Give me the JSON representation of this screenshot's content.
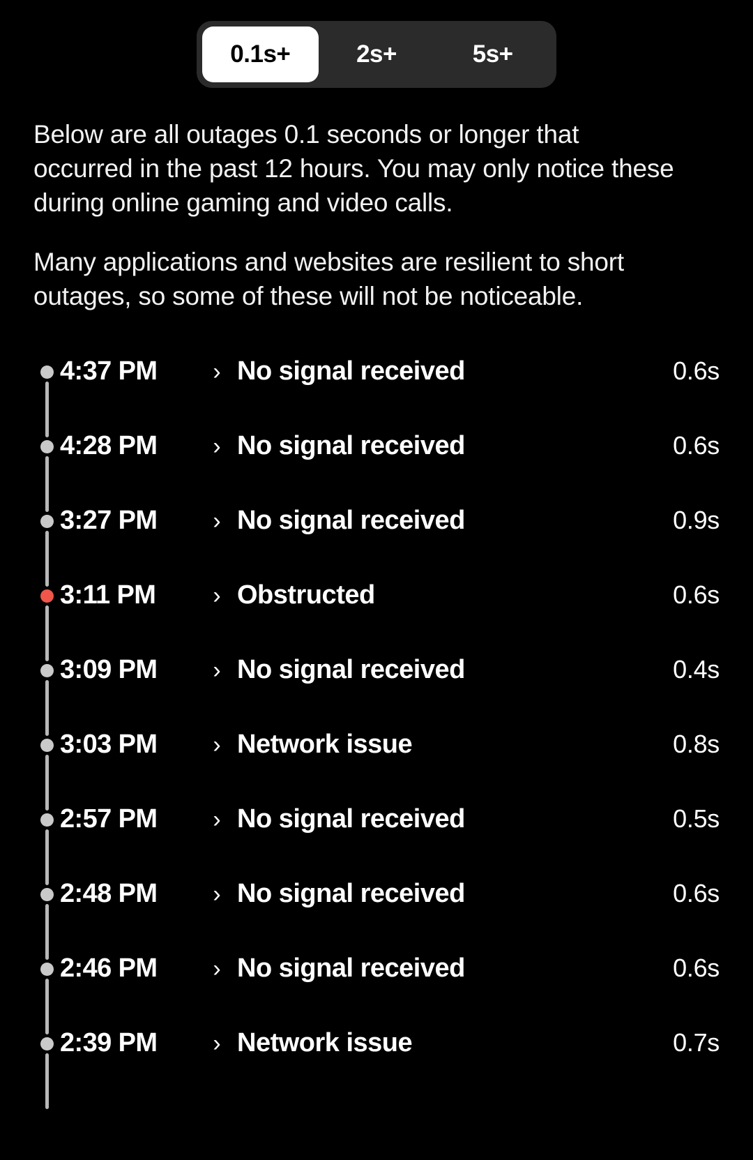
{
  "filter": {
    "options": [
      {
        "label": "0.1s+",
        "active": true
      },
      {
        "label": "2s+",
        "active": false
      },
      {
        "label": "5s+",
        "active": false
      }
    ]
  },
  "description": {
    "paragraph1": "Below are all outages 0.1 seconds or longer that occurred in the past 12 hours. You may only notice these during online gaming and video calls.",
    "paragraph2": "Many applications and websites are resilient to short outages, so some of these will not be noticeable."
  },
  "colors": {
    "background": "#000000",
    "dot_normal": "#c9c9c9",
    "dot_alert": "#f0564a",
    "segment_track": "#2b2b2b",
    "segment_active": "#ffffff"
  },
  "chevron_glyph": "›",
  "outages": [
    {
      "time": "4:37 PM",
      "reason": "No signal received",
      "duration": "0.6s",
      "severity": "normal"
    },
    {
      "time": "4:28 PM",
      "reason": "No signal received",
      "duration": "0.6s",
      "severity": "normal"
    },
    {
      "time": "3:27 PM",
      "reason": "No signal received",
      "duration": "0.9s",
      "severity": "normal"
    },
    {
      "time": "3:11 PM",
      "reason": "Obstructed",
      "duration": "0.6s",
      "severity": "alert"
    },
    {
      "time": "3:09 PM",
      "reason": "No signal received",
      "duration": "0.4s",
      "severity": "normal"
    },
    {
      "time": "3:03 PM",
      "reason": "Network issue",
      "duration": "0.8s",
      "severity": "normal"
    },
    {
      "time": "2:57 PM",
      "reason": "No signal received",
      "duration": "0.5s",
      "severity": "normal"
    },
    {
      "time": "2:48 PM",
      "reason": "No signal received",
      "duration": "0.6s",
      "severity": "normal"
    },
    {
      "time": "2:46 PM",
      "reason": "No signal received",
      "duration": "0.6s",
      "severity": "normal"
    },
    {
      "time": "2:39 PM",
      "reason": "Network issue",
      "duration": "0.7s",
      "severity": "normal"
    }
  ]
}
